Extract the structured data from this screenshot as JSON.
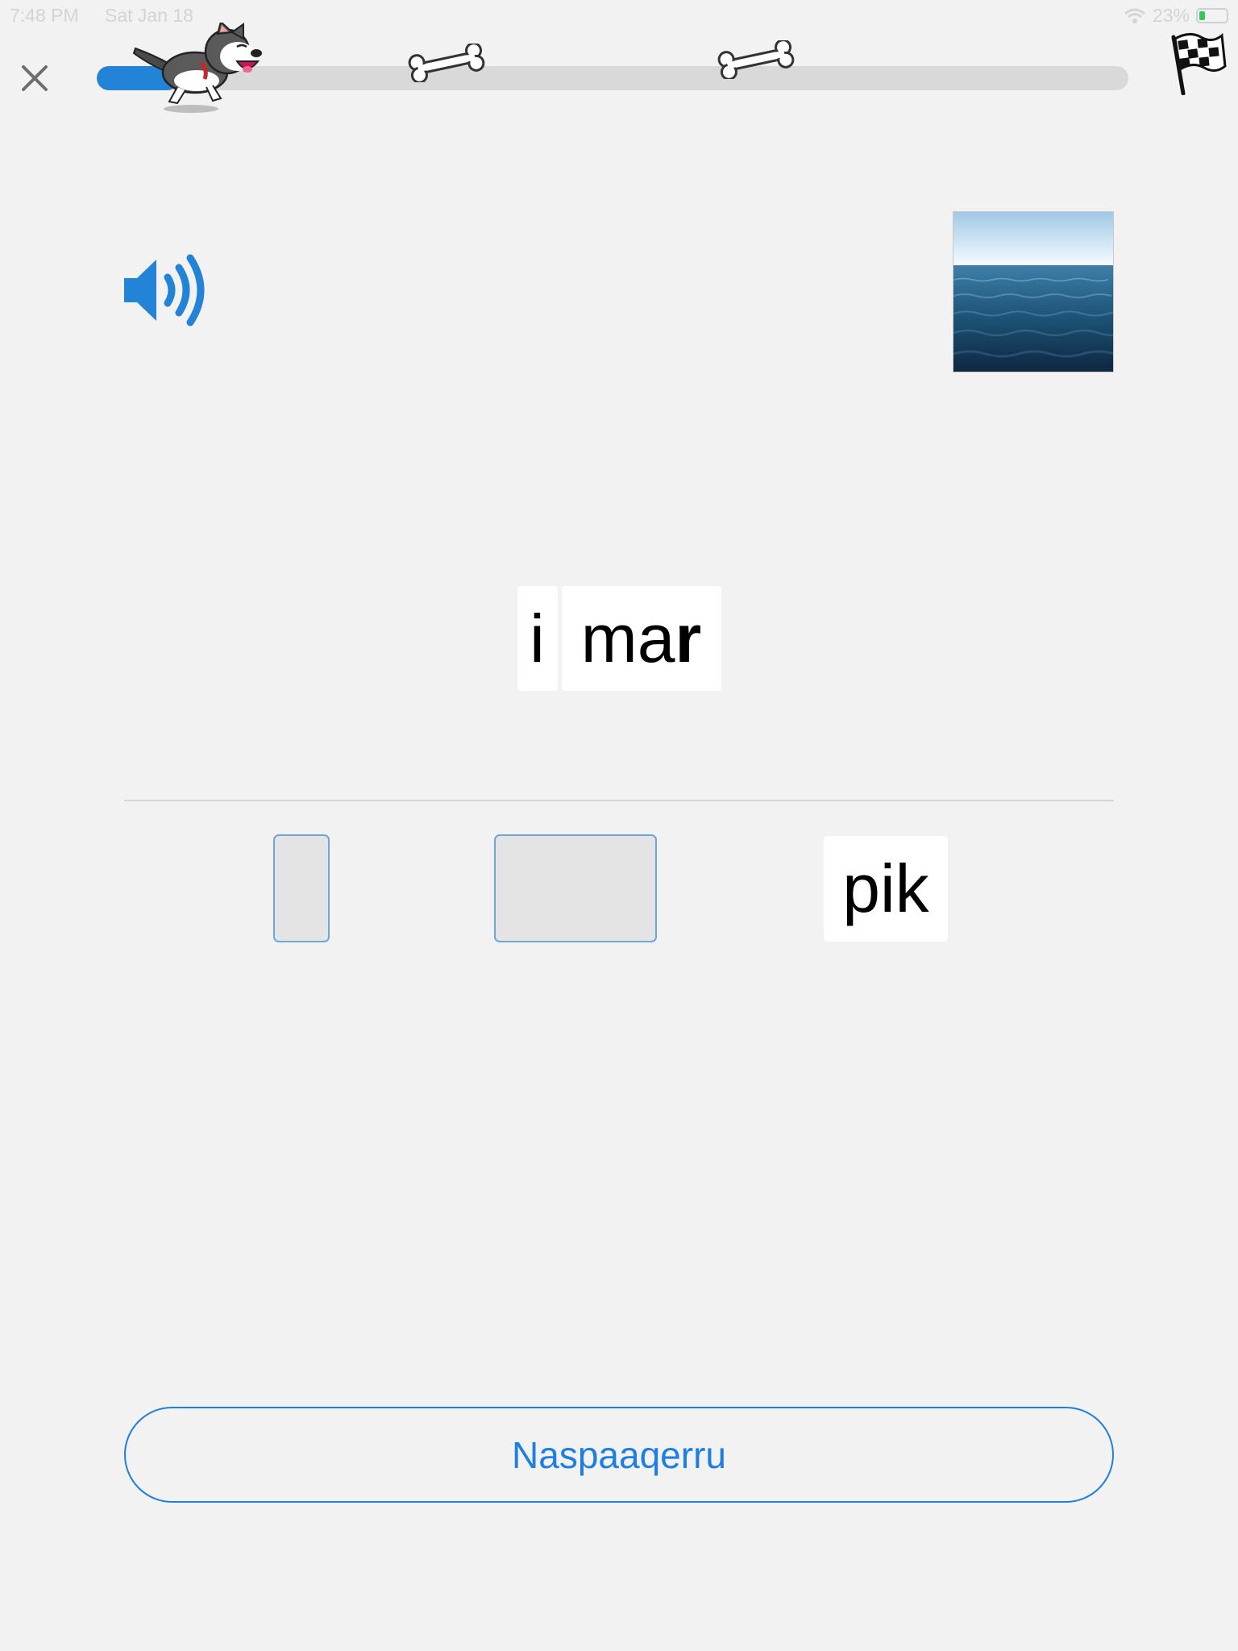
{
  "status_bar": {
    "time": "7:48 PM",
    "date": "Sat Jan 18",
    "battery_percent": "23%",
    "battery_level": 0.23
  },
  "progress": {
    "fraction": 0.08,
    "accent_color": "#2383d6"
  },
  "icons": {
    "close": "close-icon",
    "dog": "husky-dog-icon",
    "bone": "bone-icon",
    "finish": "checkered-flag-icon",
    "sound": "speaker-volume-icon",
    "picture": "sea-picture"
  },
  "word": {
    "tiles": [
      {
        "text": "i"
      },
      {
        "text_regular": "ma",
        "text_bold": "r"
      }
    ]
  },
  "choices": {
    "option": "pik"
  },
  "check_button": {
    "label": "Naspaaqerru"
  }
}
